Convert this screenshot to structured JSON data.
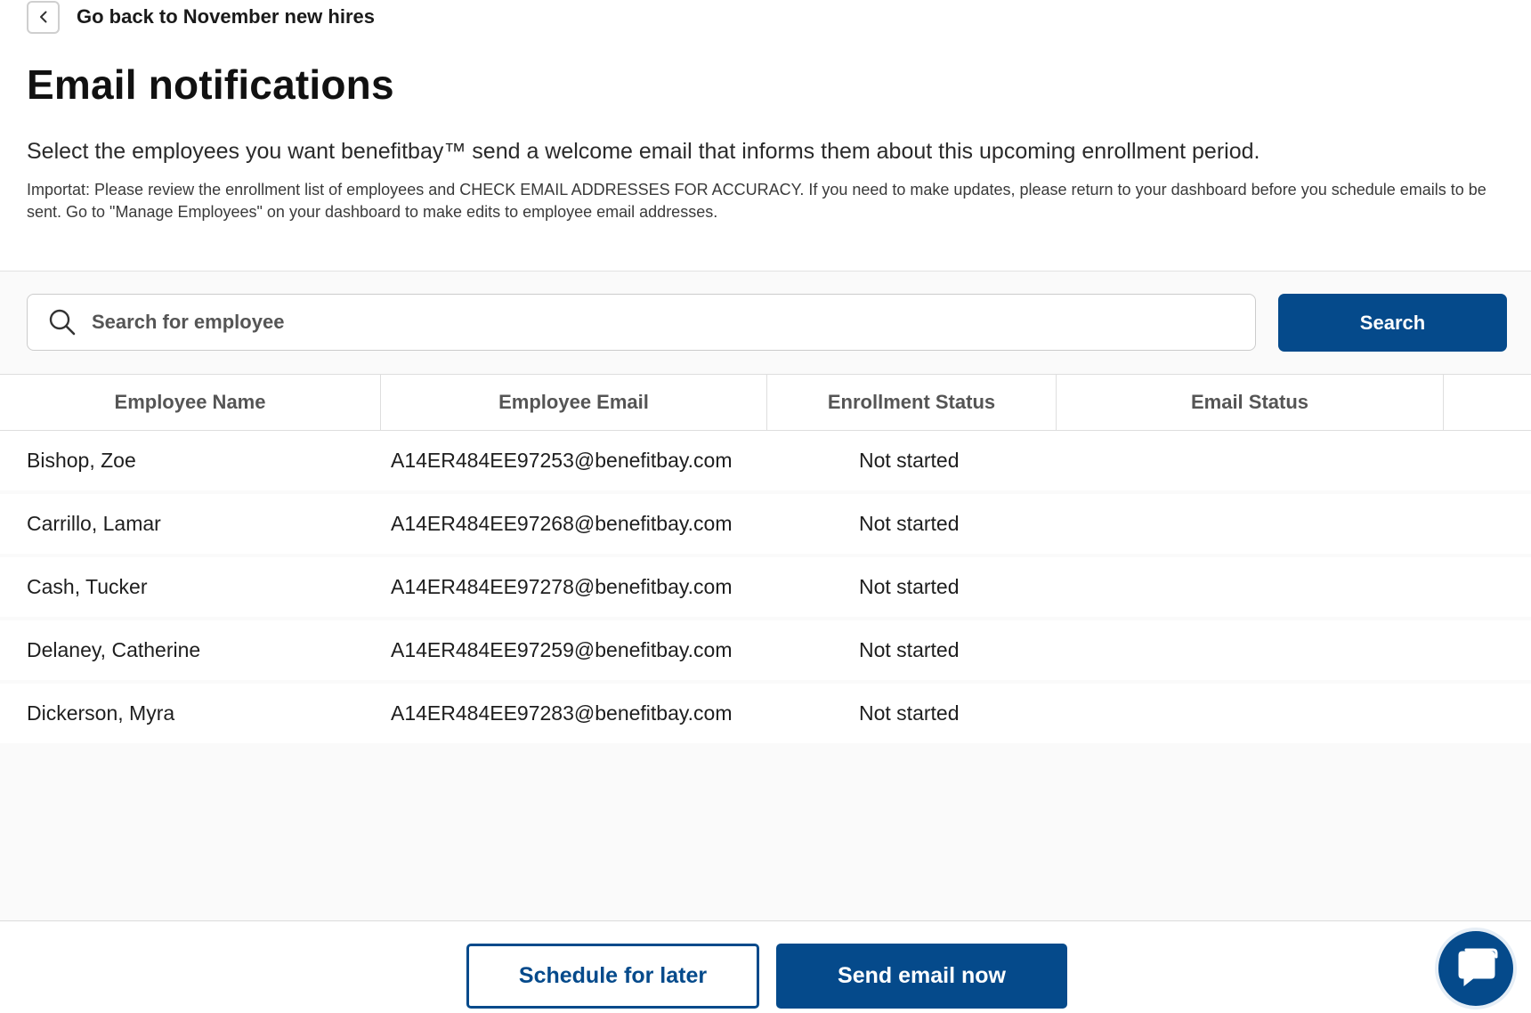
{
  "nav": {
    "back_label": "Go back to November new hires"
  },
  "header": {
    "title": "Email notifications",
    "subtitle": "Select the employees you want benefitbay™ send a welcome email that informs them about this upcoming enrollment period.",
    "notice": "Importat: Please review the enrollment list of employees and CHECK EMAIL ADDRESSES FOR ACCURACY. If you need to make updates, please return to your dashboard before you schedule emails to be sent. Go to \"Manage Employees\" on your dashboard to make edits to employee email addresses."
  },
  "search": {
    "placeholder": "Search for employee",
    "value": "",
    "button_label": "Search"
  },
  "table": {
    "columns": [
      "Employee Name",
      "Employee Email",
      "Enrollment Status",
      "Email Status"
    ],
    "rows": [
      {
        "name": "Bishop, Zoe",
        "email": "A14ER484EE97253@benefitbay.com",
        "enrollment_status": "Not started",
        "email_status": ""
      },
      {
        "name": "Carrillo, Lamar",
        "email": "A14ER484EE97268@benefitbay.com",
        "enrollment_status": "Not started",
        "email_status": ""
      },
      {
        "name": "Cash, Tucker",
        "email": "A14ER484EE97278@benefitbay.com",
        "enrollment_status": "Not started",
        "email_status": ""
      },
      {
        "name": "Delaney, Catherine",
        "email": "A14ER484EE97259@benefitbay.com",
        "enrollment_status": "Not started",
        "email_status": ""
      },
      {
        "name": "Dickerson, Myra",
        "email": "A14ER484EE97283@benefitbay.com",
        "enrollment_status": "Not started",
        "email_status": ""
      }
    ]
  },
  "footer": {
    "schedule_label": "Schedule for later",
    "send_label": "Send email now"
  },
  "icons": {
    "back": "chevron-left-icon",
    "search": "search-icon",
    "chat": "chat-bubble-icon"
  },
  "colors": {
    "primary": "#054a8b",
    "background_alt": "#fafafa",
    "border": "#dedede"
  }
}
